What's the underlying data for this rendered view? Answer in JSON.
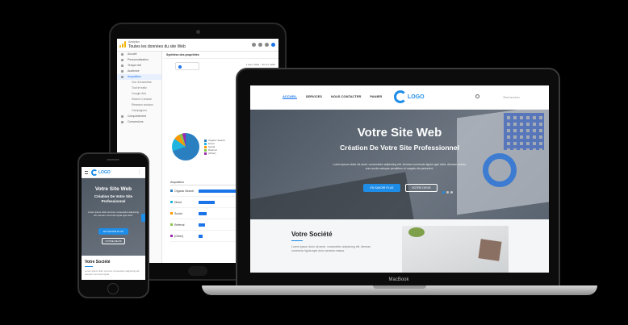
{
  "tablet": {
    "app_name": "Analytics",
    "property_name": "Toutes les données du site Web",
    "toolbar_title": "Synthèse des propriétés",
    "date_range": "1 sept. 2022 – 30 oct. 2022",
    "sidebar": [
      {
        "label": "Accueil",
        "active": false,
        "sub": false
      },
      {
        "label": "Personnalisation",
        "active": false,
        "sub": false
      },
      {
        "label": "Temps réel",
        "active": false,
        "sub": false
      },
      {
        "label": "Audience",
        "active": false,
        "sub": false
      },
      {
        "label": "Acquisition",
        "active": true,
        "sub": false
      },
      {
        "label": "Vue d'ensemble",
        "active": false,
        "sub": true
      },
      {
        "label": "Tout le trafic",
        "active": false,
        "sub": true
      },
      {
        "label": "Google Ads",
        "active": false,
        "sub": true
      },
      {
        "label": "Search Console",
        "active": false,
        "sub": true
      },
      {
        "label": "Réseaux sociaux",
        "active": false,
        "sub": true
      },
      {
        "label": "Campagnes",
        "active": false,
        "sub": true
      },
      {
        "label": "Comportement",
        "active": false,
        "sub": false
      },
      {
        "label": "Conversions",
        "active": false,
        "sub": false
      }
    ],
    "legend": [
      "Organic Search",
      "Direct",
      "Social",
      "Referral",
      "(Other)"
    ],
    "table_header": "Acquisition",
    "rows": [
      {
        "name": "Organic Search",
        "color": "#2a7fc1"
      },
      {
        "name": "Direct",
        "color": "#1fb5e0"
      },
      {
        "name": "Social",
        "color": "#ff9800"
      },
      {
        "name": "Referral",
        "color": "#8bc34a"
      },
      {
        "name": "(Other)",
        "color": "#9c27b0"
      }
    ]
  },
  "laptop": {
    "menu": [
      "ACCUEIL",
      "SERVICES",
      "NOUS CONTACTER",
      "PANIER"
    ],
    "logo_text": "LOGO",
    "search_placeholder": "Rechercher",
    "hero_title": "Votre Site Web",
    "hero_subtitle": "Création De Votre Site Professionnel",
    "hero_text": "Lorem ipsum dolor sit amet, consectetur adipiscing elit. Aenean commodo ligula eget dolor. Aenean massa cum sociis natoque penatibus et magnis dis parturient.",
    "cta_primary": "EN SAVOIR PLUS",
    "cta_secondary": "VOTRE DEVIS",
    "about_title": "Votre Société",
    "about_text": "Lorem ipsum dolor sit amet, consectetur adipiscing elit. Aenean commodo ligula eget dolor aenean massa.",
    "brand_label": "MacBook"
  },
  "phone": {
    "logo_text": "LOGO",
    "hero_title": "Votre Site Web",
    "hero_subtitle": "Création De Votre Site Professionnel",
    "hero_text": "Lorem ipsum dolor sit amet, consectetur adipiscing elit. Aenean commodo ligula eget dolor.",
    "cta_primary": "EN SAVOIR PLUS",
    "cta_secondary": "VOTRE DEVIS",
    "about_title": "Votre Société",
    "about_text": "Lorem ipsum dolor sit amet, consectetur adipiscing elit. Aenean commodo ligula."
  }
}
